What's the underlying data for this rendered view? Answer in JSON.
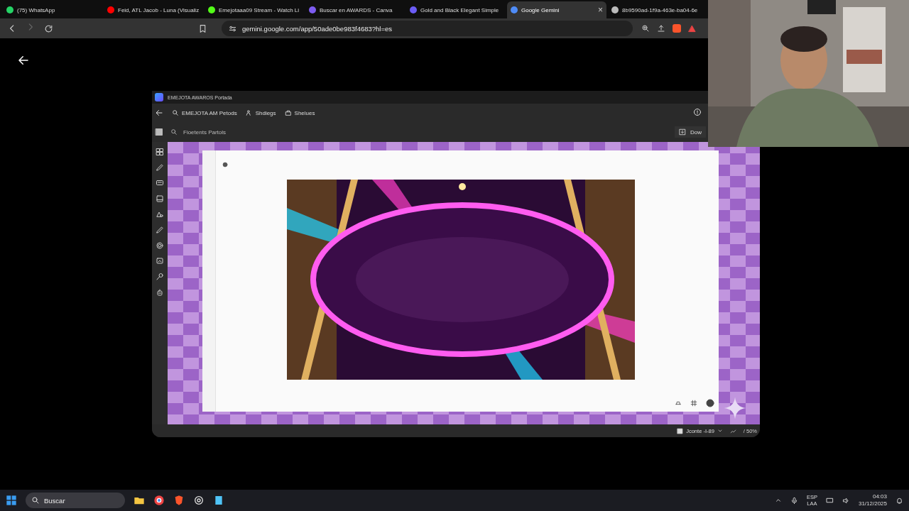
{
  "browser": {
    "tabs": [
      {
        "label": "(75) WhatsApp",
        "selected": false,
        "color": "#25d366"
      },
      {
        "label": "Feid, ATL Jacob - Luna (Visualiz",
        "selected": false,
        "color": "#ff0000"
      },
      {
        "label": "Emejotaaa09 Stream - Watch Li",
        "selected": false,
        "color": "#53fc18"
      },
      {
        "label": "Buscar en AWARDS - Canva",
        "selected": false,
        "color": "#7d5cf0"
      },
      {
        "label": "Gold and Black Elegant Simple",
        "selected": false,
        "color": "#6b5cf5"
      },
      {
        "label": "Google Gemini",
        "selected": true,
        "color": "#4f8cf7"
      },
      {
        "label": "8b9590ad-1f9a-463e-ba04-6e",
        "selected": false,
        "color": "#bbbbbb"
      }
    ],
    "close": "×",
    "url": "gemini.google.com/app/50ade0be983f4683?hl=es"
  },
  "editor": {
    "title": "EMEJOTA AWAROS Portada",
    "toolbar": [
      "EMEJOTA AM Petods",
      "Shdiegs",
      "Shelues"
    ],
    "search": "Fioetents Partols",
    "download": "Dow",
    "status": "Jconte -I-89",
    "zoom": "/ 50%"
  },
  "taskbar": {
    "search": {
      "placeholder": "Buscar"
    },
    "lang": "ESP",
    "layout": "LAA",
    "time": "04:03",
    "date": "31/12/2025"
  }
}
